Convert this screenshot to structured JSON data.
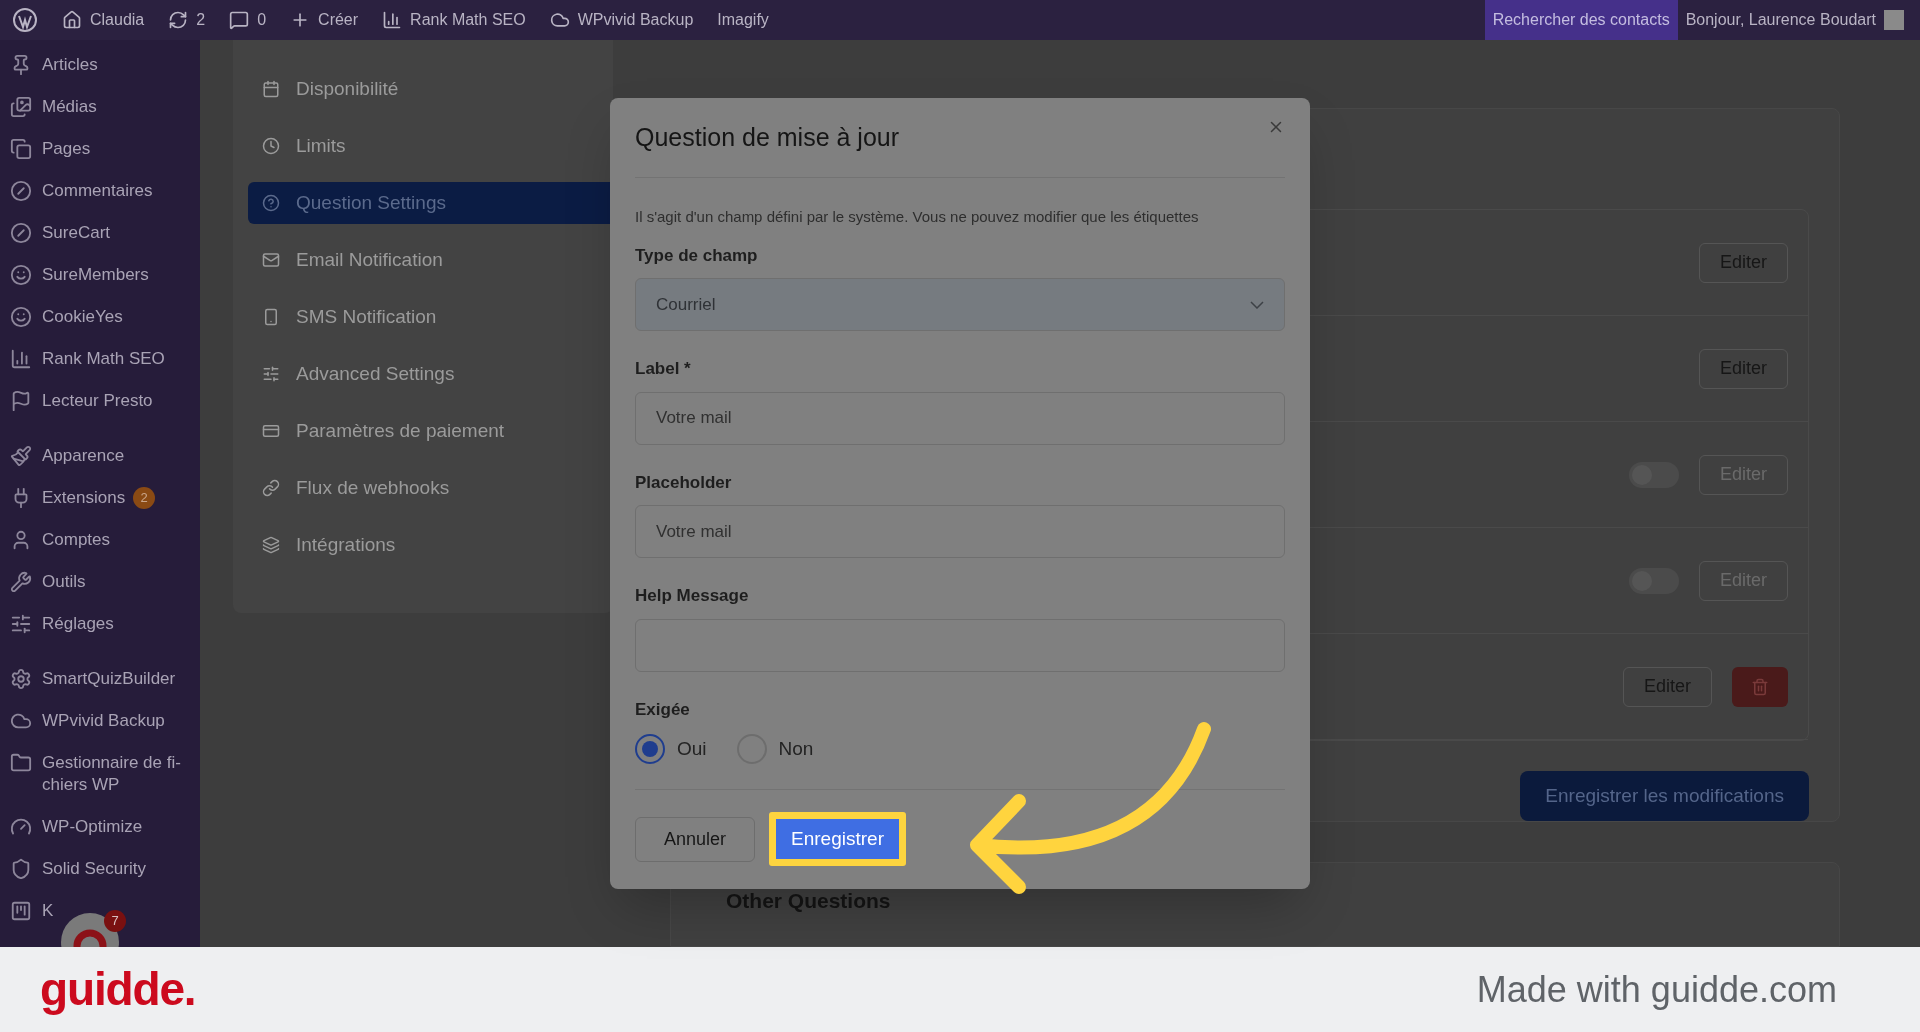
{
  "top_bar": {
    "items": [
      {
        "label": "Claudia"
      },
      {
        "label": "2"
      },
      {
        "label": "0"
      },
      {
        "label": "Créer"
      },
      {
        "label": "Rank Math SEO"
      },
      {
        "label": "WPvivid Backup"
      },
      {
        "label": "Imagify"
      }
    ],
    "search_contacts": "Rechercher des contacts",
    "greeting": "Bonjour, Laurence Boudart"
  },
  "sidebar": {
    "groups": [
      {
        "items": [
          {
            "label": "Articles"
          },
          {
            "label": "Médias"
          },
          {
            "label": "Pages"
          },
          {
            "label": "Commentaires"
          },
          {
            "label": "SureCart"
          },
          {
            "label": "SureMembers"
          },
          {
            "label": "CookieYes"
          },
          {
            "label": "Rank Math SEO"
          },
          {
            "label": "Lecteur Presto"
          }
        ]
      },
      {
        "items": [
          {
            "label": "Apparence"
          },
          {
            "label": "Extensions",
            "badge": "2"
          },
          {
            "label": "Comptes"
          },
          {
            "label": "Outils"
          },
          {
            "label": "Réglages"
          }
        ]
      },
      {
        "items": [
          {
            "label": "SmartQuizBuilder"
          },
          {
            "label": "WPvivid Backup"
          },
          {
            "label": "Gestionnaire de fi-chiers WP"
          },
          {
            "label": "WP-Optimize"
          },
          {
            "label": "Solid Security"
          },
          {
            "label": "K"
          }
        ]
      }
    ],
    "chat_badge": "7"
  },
  "settings_nav": {
    "items": [
      {
        "label": "Disponibilité",
        "selected": false
      },
      {
        "label": "Limits",
        "selected": false
      },
      {
        "label": "Question Settings",
        "selected": true
      },
      {
        "label": "Email Notification",
        "selected": false
      },
      {
        "label": "SMS Notification",
        "selected": false
      },
      {
        "label": "Advanced Settings",
        "selected": false
      },
      {
        "label": "Paramètres de paiement",
        "selected": false
      },
      {
        "label": "Flux de webhooks",
        "selected": false
      },
      {
        "label": "Intégrations",
        "selected": false
      }
    ]
  },
  "questions": {
    "rows": [
      {
        "kind": "plain",
        "edit": "Editer",
        "disabled": false
      },
      {
        "kind": "plain",
        "edit": "Editer",
        "disabled": false
      },
      {
        "kind": "toggle",
        "on": false,
        "edit": "Editer",
        "disabled": true
      },
      {
        "kind": "toggle",
        "on": false,
        "edit": "Editer",
        "disabled": true
      },
      {
        "kind": "deletable",
        "edit": "Editer",
        "disabled": false
      }
    ],
    "save": "Enregistrer les modifications"
  },
  "other_questions": {
    "title": "Other Questions"
  },
  "dialog": {
    "title": "Question de mise à jour",
    "notice": "Il s'agit d'un champ défini par le système. Vous ne pouvez modifier que les étiquettes",
    "field_type": {
      "label": "Type de champ",
      "value": "Courriel"
    },
    "fields": [
      {
        "label": "Label *",
        "value": "Votre mail"
      },
      {
        "label": "Placeholder",
        "value": "Votre mail"
      },
      {
        "label": "Help Message"
      }
    ],
    "required": {
      "label": "Exigée",
      "options": [
        {
          "label": "Oui",
          "selected": true
        },
        {
          "label": "Non",
          "selected": false
        }
      ]
    },
    "cancel": "Annuler",
    "save": "Enregistrer"
  },
  "footer": {
    "logo": "guidde.",
    "tagline": "Made with guidde.com"
  }
}
